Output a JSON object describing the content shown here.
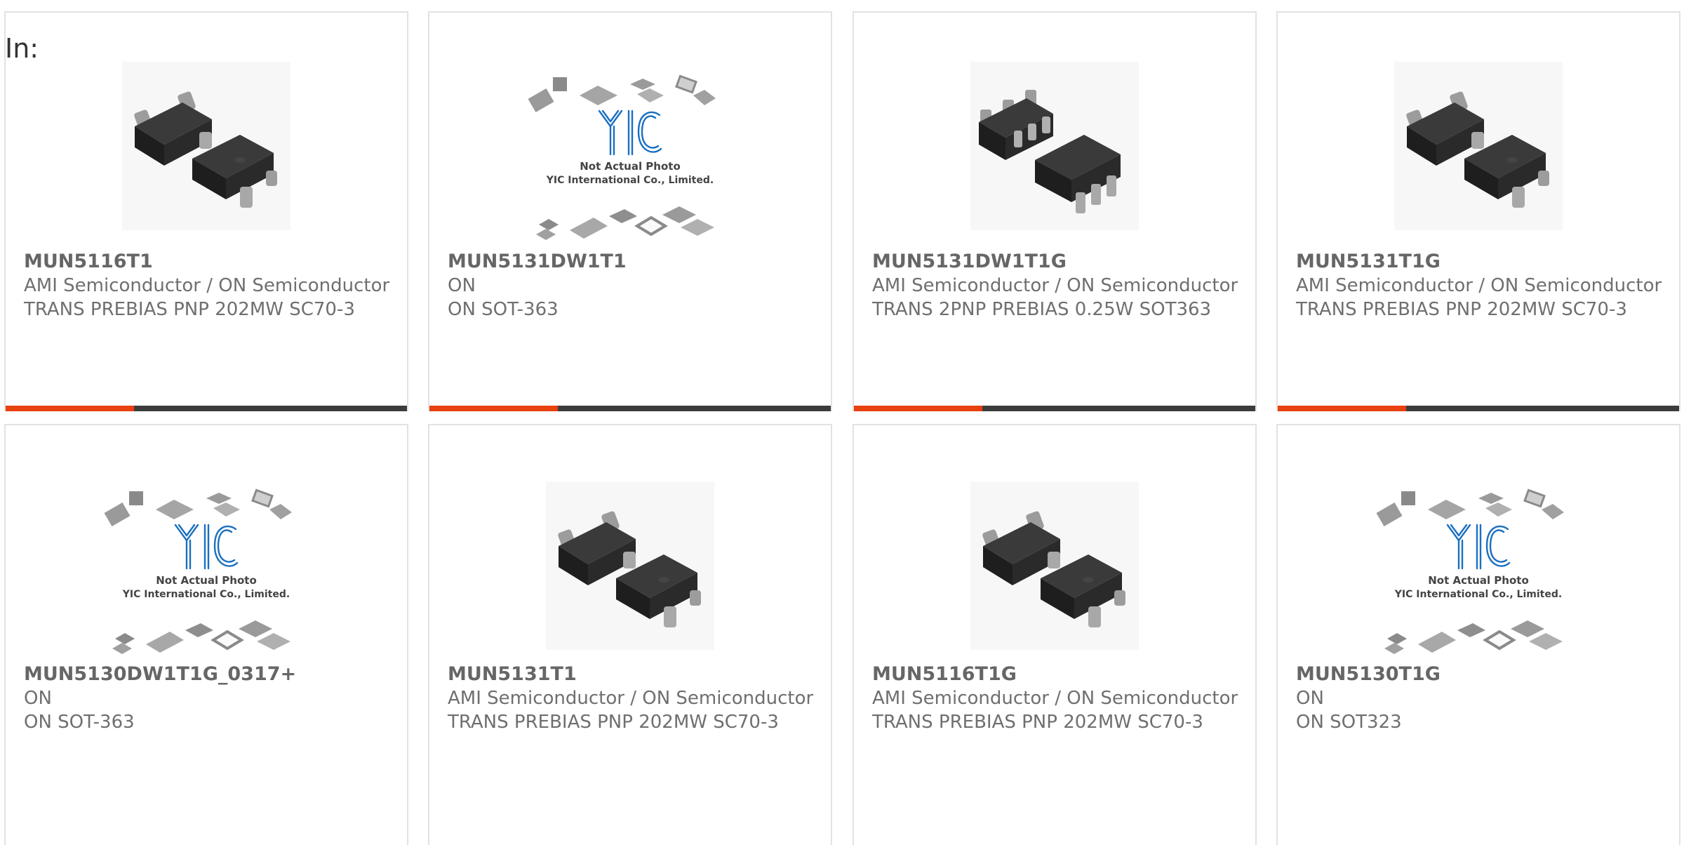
{
  "filter_label": "In:",
  "placeholder_image_text": {
    "line1": "Not Actual Photo",
    "line2": "YIC International Co., Limited."
  },
  "products": [
    {
      "part": "MUN5116T1",
      "manufacturer": "AMI Semiconductor / ON Semiconductor",
      "description": "TRANS PREBIAS PNP 202MW SC70-3",
      "image": "sc70-3-package"
    },
    {
      "part": "MUN5131DW1T1",
      "manufacturer": "ON",
      "description": "ON SOT-363",
      "image": "placeholder"
    },
    {
      "part": "MUN5131DW1T1G",
      "manufacturer": "AMI Semiconductor / ON Semiconductor",
      "description": "TRANS 2PNP PREBIAS 0.25W SOT363",
      "image": "sot363-package"
    },
    {
      "part": "MUN5131T1G",
      "manufacturer": "AMI Semiconductor / ON Semiconductor",
      "description": "TRANS PREBIAS PNP 202MW SC70-3",
      "image": "sc70-3-package"
    },
    {
      "part": "MUN5130DW1T1G_0317+",
      "manufacturer": "ON",
      "description": "ON SOT-363",
      "image": "placeholder"
    },
    {
      "part": "MUN5131T1",
      "manufacturer": "AMI Semiconductor / ON Semiconductor",
      "description": "TRANS PREBIAS PNP 202MW SC70-3",
      "image": "sc70-3-package"
    },
    {
      "part": "MUN5116T1G",
      "manufacturer": "AMI Semiconductor / ON Semiconductor",
      "description": "TRANS PREBIAS PNP 202MW SC70-3",
      "image": "sc70-3-package"
    },
    {
      "part": "MUN5130T1G",
      "manufacturer": "ON",
      "description": "ON SOT323",
      "image": "placeholder"
    }
  ],
  "colors": {
    "accent": "#e8400e",
    "bar": "#3c3c3c",
    "text": "#6f6f6f",
    "logo": "#1a6fc0"
  }
}
